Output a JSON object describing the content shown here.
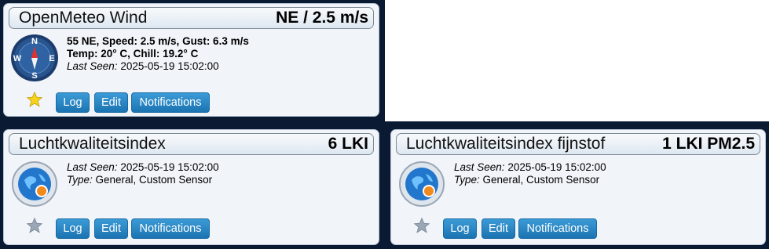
{
  "colors": {
    "dark_bg": "#0a1a33",
    "card_bg": "#f1f4f9",
    "button": "#2a88c6",
    "star_active": "#f6d21f",
    "star_inactive": "#9aa7b6"
  },
  "cards": [
    {
      "name": "OpenMeteo Wind",
      "value": "NE / 2.5 m/s",
      "icon": "compass-icon",
      "compass_letters": {
        "north": "N",
        "south": "S",
        "east": "E",
        "west": "W"
      },
      "line1": "55 NE, Speed: 2.5 m/s, Gust: 6.3 m/s",
      "line2": "Temp: 20° C, Chill: 19.2° C",
      "last_seen_label": "Last Seen:",
      "last_seen": "2025-05-19 15:02:00",
      "favorite": true,
      "buttons": {
        "log": "Log",
        "edit": "Edit",
        "notifications": "Notifications"
      }
    },
    {
      "name": "Luchtkwaliteitsindex",
      "value": "6 LKI",
      "icon": "custom-sensor-globe-icon",
      "last_seen_label": "Last Seen:",
      "last_seen": "2025-05-19 15:02:00",
      "type_label": "Type:",
      "type": "General, Custom Sensor",
      "favorite": false,
      "buttons": {
        "log": "Log",
        "edit": "Edit",
        "notifications": "Notifications"
      }
    },
    {
      "name": "Luchtkwaliteitsindex fijnstof",
      "value": "1 LKI PM2.5",
      "icon": "custom-sensor-globe-icon",
      "last_seen_label": "Last Seen:",
      "last_seen": "2025-05-19 15:02:00",
      "type_label": "Type:",
      "type": "General, Custom Sensor",
      "favorite": false,
      "buttons": {
        "log": "Log",
        "edit": "Edit",
        "notifications": "Notifications"
      }
    }
  ]
}
